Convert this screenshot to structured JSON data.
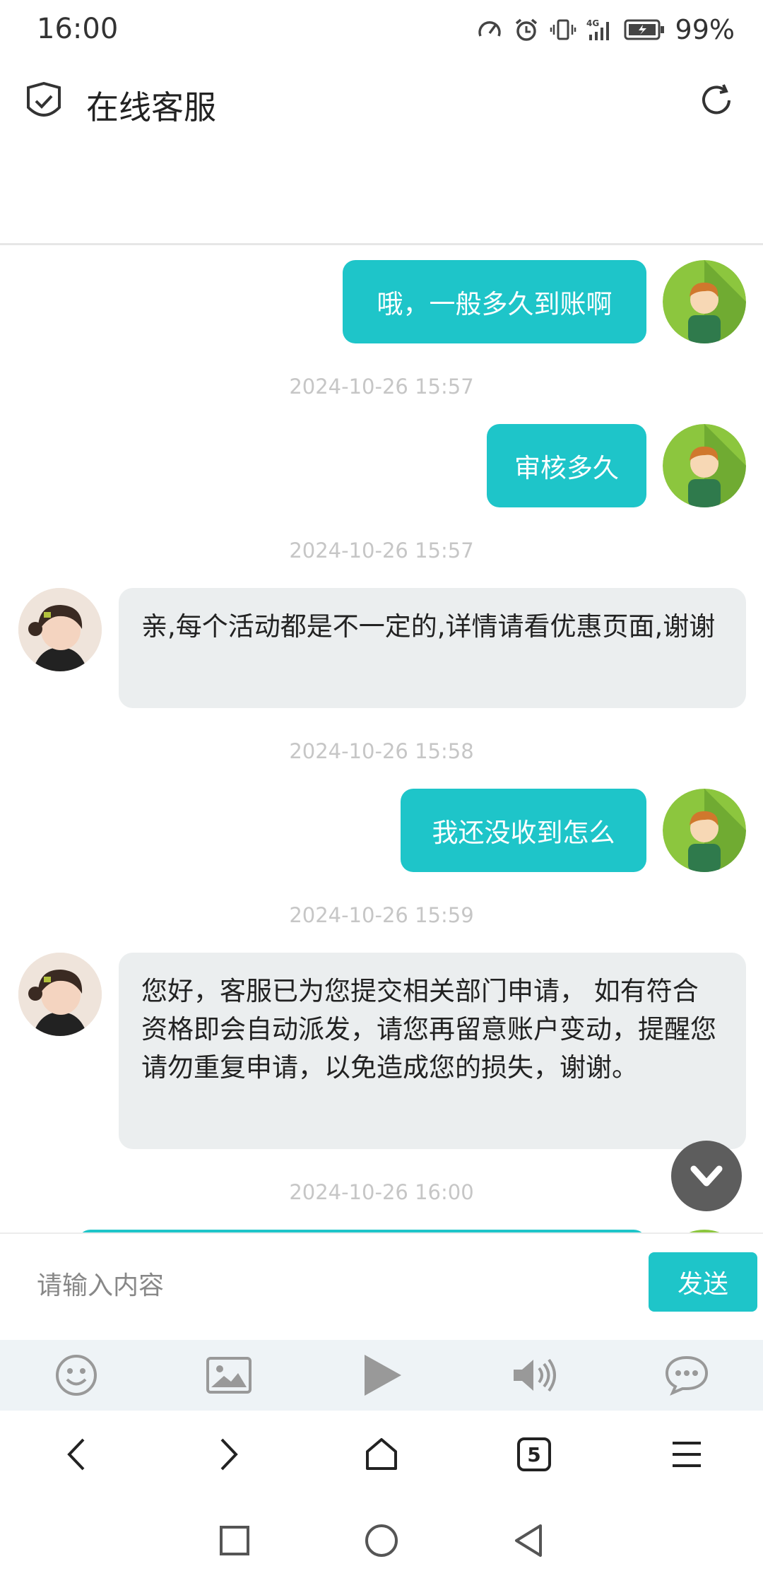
{
  "status_bar": {
    "time": "16:00",
    "battery_percent": "99%",
    "icons": [
      "speedometer-icon",
      "alarm-icon",
      "vibrate-icon",
      "signal-4g-icon",
      "battery-icon"
    ]
  },
  "header": {
    "title": "在线客服",
    "left_icon": "shield-check-icon",
    "right_icon": "refresh-icon"
  },
  "messages": [
    {
      "from": "me",
      "text": "哦，一般多久到账啊"
    },
    {
      "timestamp": "2024-10-26 15:57"
    },
    {
      "from": "me",
      "text": "审核多久"
    },
    {
      "timestamp": "2024-10-26 15:57"
    },
    {
      "from": "agent",
      "text": "亲,每个活动都是不一定的,详情请看优惠页面,谢谢"
    },
    {
      "timestamp": "2024-10-26 15:58"
    },
    {
      "from": "me",
      "text": "我还没收到怎么"
    },
    {
      "timestamp": "2024-10-26 15:59"
    },
    {
      "from": "agent",
      "text": "您好，客服已为您提交相关部门申请， 如有符合资格即会自动派发，请您再留意账户变动，提醒您请勿重复申请，以免造成您的损失，谢谢。"
    },
    {
      "timestamp": "2024-10-26 16:00"
    }
  ],
  "composer": {
    "placeholder": "请输入内容",
    "send_label": "发送"
  },
  "toolbar": [
    "emoji-icon",
    "image-icon",
    "play-icon",
    "volume-icon",
    "chat-bubble-icon"
  ],
  "browser_nav": {
    "tabs_count": "5",
    "icons": [
      "back-arrow-icon",
      "forward-arrow-icon",
      "home-icon",
      "tabs-icon",
      "menu-icon"
    ]
  },
  "system_nav": [
    "recent-apps-icon",
    "home-circle-icon",
    "back-triangle-icon"
  ],
  "colors": {
    "accent": "#1ec5c9",
    "agent_bubble": "#ebeeef",
    "timestamp": "#c6c6c6"
  }
}
